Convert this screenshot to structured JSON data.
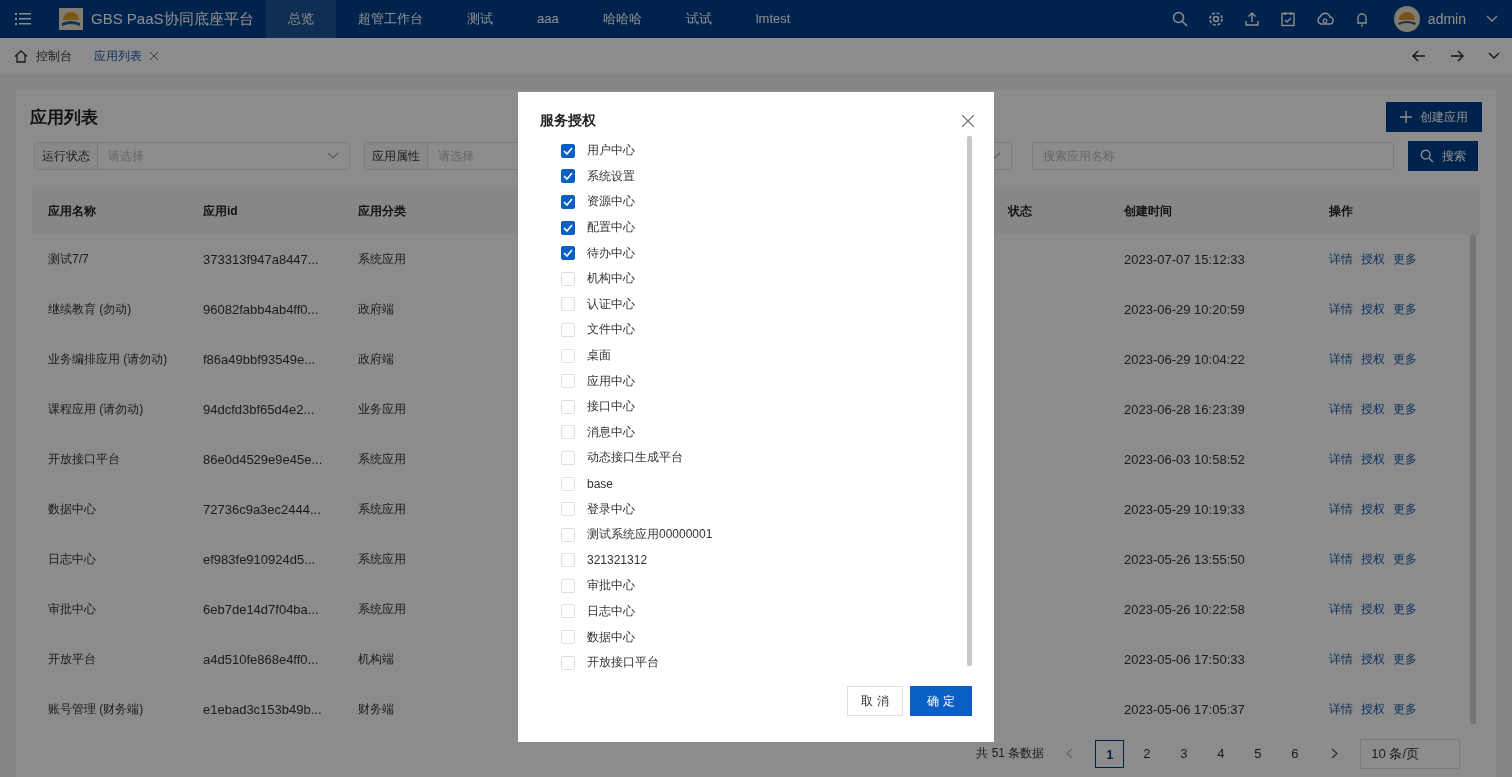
{
  "header": {
    "app_title": "GBS PaaS协同底座平台",
    "nav": [
      {
        "label": "总览",
        "selected": true
      },
      {
        "label": "超管工作台",
        "selected": false
      },
      {
        "label": "测试",
        "selected": false
      },
      {
        "label": "aaa",
        "selected": false
      },
      {
        "label": "哈哈哈",
        "selected": false
      },
      {
        "label": "试试",
        "selected": false
      },
      {
        "label": "lmtest",
        "selected": false
      }
    ],
    "user": "admin"
  },
  "tabs": [
    {
      "label": "控制台",
      "selected": false,
      "closable": false
    },
    {
      "label": "应用列表",
      "selected": true,
      "closable": true
    }
  ],
  "page": {
    "title": "应用列表",
    "create_button": "创建应用",
    "filters": [
      {
        "label": "运行状态",
        "placeholder": "请选择"
      },
      {
        "label": "应用属性",
        "placeholder": "请选择"
      }
    ],
    "search_placeholder": "搜索应用名称",
    "search_button": "搜索"
  },
  "table": {
    "columns": [
      "应用名称",
      "应用id",
      "应用分类",
      "状态",
      "创建时间",
      "操作"
    ],
    "rows": [
      {
        "name": "测试7/7",
        "id": "373313f947a8447...",
        "category": "系统应用",
        "created": "2023-07-07 15:12:33",
        "actions": [
          "详情",
          "授权",
          "更多"
        ]
      },
      {
        "name": "继续教育 (勿动)",
        "id": "96082fabb4ab4ff0...",
        "category": "政府端",
        "created": "2023-06-29 10:20:59",
        "actions": [
          "详情",
          "授权",
          "更多"
        ]
      },
      {
        "name": "业务编排应用 (请勿动)",
        "id": "f86a49bbf93549e...",
        "category": "政府端",
        "created": "2023-06-29 10:04:22",
        "actions": [
          "详情",
          "授权",
          "更多"
        ]
      },
      {
        "name": "课程应用 (请勿动)",
        "id": "94dcfd3bf65d4e2...",
        "category": "业务应用",
        "created": "2023-06-28 16:23:39",
        "actions": [
          "详情",
          "授权",
          "更多"
        ]
      },
      {
        "name": "开放接口平台",
        "id": "86e0d4529e9e45e...",
        "category": "系统应用",
        "created": "2023-06-03 10:58:52",
        "actions": [
          "详情",
          "授权",
          "更多"
        ]
      },
      {
        "name": "数据中心",
        "id": "72736c9a3ec2444...",
        "category": "系统应用",
        "created": "2023-05-29 10:19:33",
        "actions": [
          "详情",
          "授权",
          "更多"
        ]
      },
      {
        "name": "日志中心",
        "id": "ef983fe910924d5...",
        "category": "系统应用",
        "created": "2023-05-26 13:55:50",
        "actions": [
          "详情",
          "授权",
          "更多"
        ]
      },
      {
        "name": "审批中心",
        "id": "6eb7de14d7f04ba...",
        "category": "系统应用",
        "created": "2023-05-26 10:22:58",
        "actions": [
          "详情",
          "授权",
          "更多"
        ]
      },
      {
        "name": "开放平台",
        "id": "a4d510fe868e4ff0...",
        "category": "机构端",
        "created": "2023-05-06 17:50:33",
        "actions": [
          "详情",
          "授权",
          "更多"
        ]
      },
      {
        "name": "账号管理 (财务端)",
        "id": "e1ebad3c153b49b...",
        "category": "财务端",
        "created": "2023-05-06 17:05:37",
        "actions": [
          "详情",
          "授权",
          "更多"
        ]
      }
    ]
  },
  "pagination": {
    "total": "共 51 条数据",
    "pages": [
      {
        "label": "1",
        "selected": true
      },
      {
        "label": "2",
        "selected": false
      },
      {
        "label": "3",
        "selected": false
      },
      {
        "label": "4",
        "selected": false
      },
      {
        "label": "5",
        "selected": false
      },
      {
        "label": "6",
        "selected": false
      }
    ],
    "page_size": "10 条/页"
  },
  "dialog": {
    "title": "服务授权",
    "items": [
      {
        "label": "用户中心",
        "checked": true
      },
      {
        "label": "系统设置",
        "checked": true
      },
      {
        "label": "资源中心",
        "checked": true
      },
      {
        "label": "配置中心",
        "checked": true
      },
      {
        "label": "待办中心",
        "checked": true
      },
      {
        "label": "机构中心",
        "checked": false
      },
      {
        "label": "认证中心",
        "checked": false
      },
      {
        "label": "文件中心",
        "checked": false
      },
      {
        "label": "桌面",
        "checked": false
      },
      {
        "label": "应用中心",
        "checked": false
      },
      {
        "label": "接口中心",
        "checked": false
      },
      {
        "label": "消息中心",
        "checked": false
      },
      {
        "label": "动态接口生成平台",
        "checked": false
      },
      {
        "label": "base",
        "checked": false
      },
      {
        "label": "登录中心",
        "checked": false
      },
      {
        "label": "测试系统应用00000001",
        "checked": false
      },
      {
        "label": "321321312",
        "checked": false
      },
      {
        "label": "审批中心",
        "checked": false
      },
      {
        "label": "日志中心",
        "checked": false
      },
      {
        "label": "数据中心",
        "checked": false
      },
      {
        "label": "开放接口平台",
        "checked": false
      }
    ],
    "cancel": "取 消",
    "ok": "确 定"
  }
}
